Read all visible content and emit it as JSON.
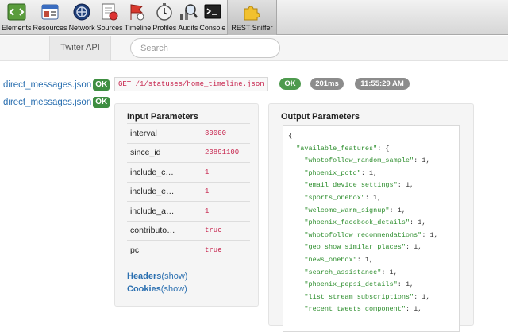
{
  "toolbar": {
    "items": [
      {
        "label": "Elements",
        "icon": "elements-icon"
      },
      {
        "label": "Resources",
        "icon": "resources-icon"
      },
      {
        "label": "Network",
        "icon": "network-icon"
      },
      {
        "label": "Sources",
        "icon": "sources-icon"
      },
      {
        "label": "Timeline",
        "icon": "timeline-icon"
      },
      {
        "label": "Profiles",
        "icon": "profiles-icon"
      },
      {
        "label": "Audits",
        "icon": "audits-icon"
      },
      {
        "label": "Console",
        "icon": "console-icon"
      },
      {
        "label": "REST Sniffer",
        "icon": "puzzle-icon"
      }
    ],
    "active": "REST Sniffer"
  },
  "tabbar": {
    "tab_label": "Twiter API",
    "search_placeholder": "Search"
  },
  "requests": [
    {
      "name": "direct_messages.json",
      "status": "OK"
    },
    {
      "name": "direct_messages.json",
      "status": "OK"
    }
  ],
  "detail": {
    "request_line": "GET /1/statuses/home_timeline.json",
    "status": "OK",
    "duration": "201ms",
    "time": "11:55:29 AM"
  },
  "input": {
    "title": "Input Parameters",
    "params": [
      {
        "key": "interval",
        "value": "30000"
      },
      {
        "key": "since_id",
        "value": "23891100"
      },
      {
        "key": "include_c…",
        "value": "1"
      },
      {
        "key": "include_e…",
        "value": "1"
      },
      {
        "key": "include_a…",
        "value": "1"
      },
      {
        "key": "contributo…",
        "value": "true"
      },
      {
        "key": "pc",
        "value": "true"
      }
    ],
    "headers_label": "Headers",
    "cookies_label": "Cookies",
    "show_label": "(show)"
  },
  "output": {
    "title": "Output Parameters",
    "open_brace": "{",
    "root_key": "\"available_features\"",
    "entries": [
      {
        "key": "\"whotofollow_random_sample\"",
        "value": "1"
      },
      {
        "key": "\"phoenix_pctd\"",
        "value": "1"
      },
      {
        "key": "\"email_device_settings\"",
        "value": "1"
      },
      {
        "key": "\"sports_onebox\"",
        "value": "1"
      },
      {
        "key": "\"welcome_warm_signup\"",
        "value": "1"
      },
      {
        "key": "\"phoenix_facebook_details\"",
        "value": "1"
      },
      {
        "key": "\"whotofollow_recommendations\"",
        "value": "1"
      },
      {
        "key": "\"geo_show_similar_places\"",
        "value": "1"
      },
      {
        "key": "\"news_onebox\"",
        "value": "1"
      },
      {
        "key": "\"search_assistance\"",
        "value": "1"
      },
      {
        "key": "\"phoenix_pepsi_details\"",
        "value": "1"
      },
      {
        "key": "\"list_stream_subscriptions\"",
        "value": "1"
      },
      {
        "key": "\"recent_tweets_component\"",
        "value": "1"
      }
    ]
  },
  "colors": {
    "link": "#2a6fb0",
    "ok_green": "#3e8e41",
    "code_red": "#c7254e",
    "json_string": "#2f8f2f"
  }
}
